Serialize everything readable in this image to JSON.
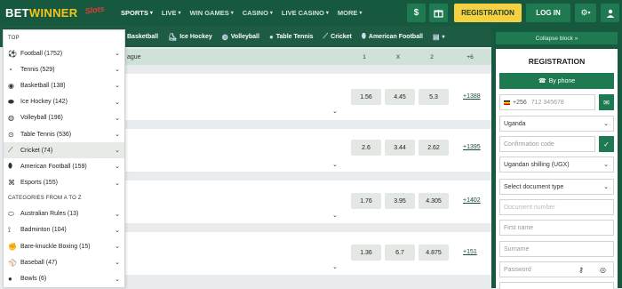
{
  "header": {
    "logo_a": "BET",
    "logo_b": "WINNER",
    "badge": "Slots",
    "nav": [
      {
        "label": "SPORTS",
        "active": true
      },
      {
        "label": "LIVE",
        "active": false
      },
      {
        "label": "WIN GAMES",
        "active": false
      },
      {
        "label": "CASINO",
        "active": false
      },
      {
        "label": "LIVE CASINO",
        "active": false
      },
      {
        "label": "MORE",
        "active": false
      }
    ],
    "dollar_icon": "$",
    "gift_icon": "gift",
    "register_label": "REGISTRATION",
    "login_label": "LOG IN"
  },
  "subbar": {
    "items": [
      "Basketball",
      "Ice Hockey",
      "Volleyball",
      "Table Tennis",
      "Cricket",
      "American Football"
    ]
  },
  "sidebar": {
    "top_heading": "TOP",
    "top_items": [
      "Football (1752)",
      "Tennis (529)",
      "Basketball (138)",
      "Ice Hockey (142)",
      "Volleyball (196)",
      "Table Tennis (536)",
      "Cricket (74)",
      "American Football (159)",
      "Esports (155)"
    ],
    "az_heading": "CATEGORIES FROM A TO Z",
    "az_items": [
      "Australian Rules (13)",
      "Badminton (104)",
      "Bare-knuckle Boxing (15)",
      "Baseball (47)",
      "Bowls (6)"
    ]
  },
  "main": {
    "league1_name": "ague",
    "col_1": "1",
    "col_x": "X",
    "col_2": "2",
    "col_more": "+6",
    "matches": [
      {
        "o1": "1.56",
        "ox": "4.45",
        "o2": "5.3",
        "more": "+1388"
      },
      {
        "o1": "2.6",
        "ox": "3.44",
        "o2": "2.62",
        "more": "+1395"
      },
      {
        "o1": "1.76",
        "ox": "3.95",
        "o2": "4.305",
        "more": "+1402"
      },
      {
        "o1": "1.36",
        "ox": "6.7",
        "o2": "4.875",
        "more": "+151"
      }
    ]
  },
  "right": {
    "collapse_label": "Collapse block »",
    "reg_title": "REGISTRATION",
    "by_phone": "By phone",
    "phone_prefix": "+256",
    "phone_placeholder": "712 345678",
    "country": "Uganda",
    "confirmation_placeholder": "Confirmation code",
    "currency": "Ugandan shilling (UGX)",
    "doc_type": "Select document type",
    "doc_number_placeholder": "Document number",
    "first_name_placeholder": "First name",
    "surname_placeholder": "Surname",
    "password_placeholder": "Password"
  }
}
